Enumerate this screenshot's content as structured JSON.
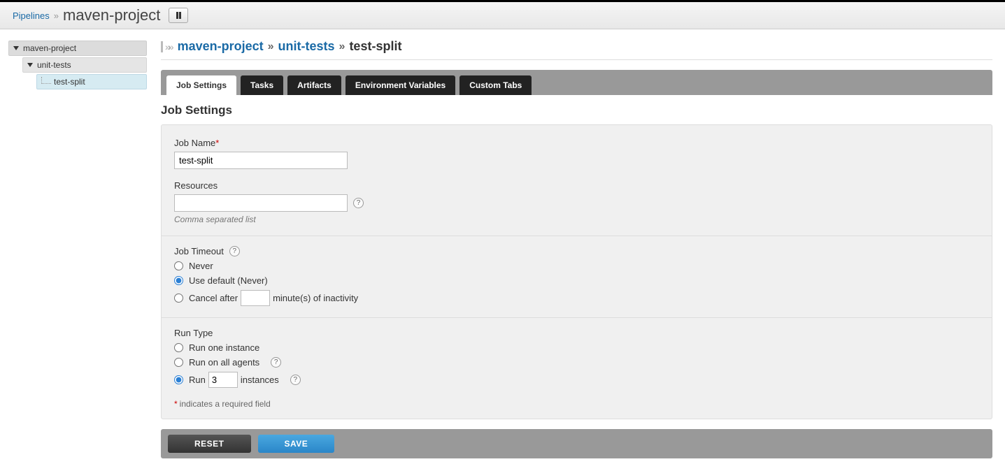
{
  "header": {
    "root_label": "Pipelines",
    "current": "maven-project"
  },
  "sidebar": {
    "items": [
      {
        "label": "maven-project"
      },
      {
        "label": "unit-tests"
      },
      {
        "label": "test-split"
      }
    ]
  },
  "breadcrumb": {
    "pipeline": "maven-project",
    "stage": "unit-tests",
    "job": "test-split"
  },
  "tabs": [
    {
      "label": "Job Settings",
      "active": true
    },
    {
      "label": "Tasks"
    },
    {
      "label": "Artifacts"
    },
    {
      "label": "Environment Variables"
    },
    {
      "label": "Custom Tabs"
    }
  ],
  "section_title": "Job Settings",
  "form": {
    "job_name_label": "Job Name",
    "job_name_value": "test-split",
    "resources_label": "Resources",
    "resources_value": "",
    "resources_hint": "Comma separated list",
    "timeout_label": "Job Timeout",
    "timeout_never": "Never",
    "timeout_default": "Use default (Never)",
    "timeout_cancel_prefix": "Cancel after",
    "timeout_cancel_suffix": "minute(s) of inactivity",
    "timeout_minutes": "",
    "runtype_label": "Run Type",
    "runtype_one": "Run one instance",
    "runtype_all": "Run on all agents",
    "runtype_n_prefix": "Run",
    "runtype_n_suffix": "instances",
    "runtype_count": "3",
    "footnote": "indicates a required field",
    "reset_label": "RESET",
    "save_label": "SAVE"
  }
}
